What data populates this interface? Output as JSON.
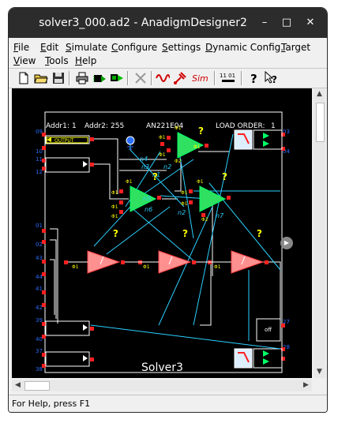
{
  "window": {
    "title": "solver3_000.ad2 - AnadigmDesigner2",
    "min_glyph": "–",
    "max_glyph": "□",
    "close_glyph": "✕"
  },
  "menus": [
    "File",
    "Edit",
    "Simulate",
    "Configure",
    "Settings",
    "Dynamic Config.",
    "Target",
    "View",
    "Tools",
    "Help"
  ],
  "menu_hotkeys": [
    "F",
    "E",
    "S",
    "C",
    "S",
    "D",
    "T",
    "V",
    "T",
    "H"
  ],
  "toolbar": {
    "sim_label": "Sim",
    "bits_label": "11 01"
  },
  "chip": {
    "addr1_label": "Addr1:",
    "addr1_value": "1",
    "addr2_label": "Addr2:",
    "addr2_value": "255",
    "part": "AN221E04",
    "load_label": "LOAD ORDER:",
    "load_value": "1",
    "name": "Solver3",
    "output_label": "OUTPUT",
    "off_label": "off",
    "pins_left": [
      "09",
      "10",
      "11",
      "12",
      "01",
      "02",
      "43",
      "44",
      "41",
      "42",
      "39",
      "40",
      "37",
      "38"
    ],
    "pins_right": [
      "03",
      "04",
      "27",
      "28"
    ],
    "nets": [
      "n4",
      "n3",
      "n1",
      "n2",
      "n5",
      "n6",
      "n2",
      "n7"
    ],
    "phi1": "Φ1",
    "phi2": "Φ2",
    "q": "?"
  },
  "status": "For Help, press F1"
}
